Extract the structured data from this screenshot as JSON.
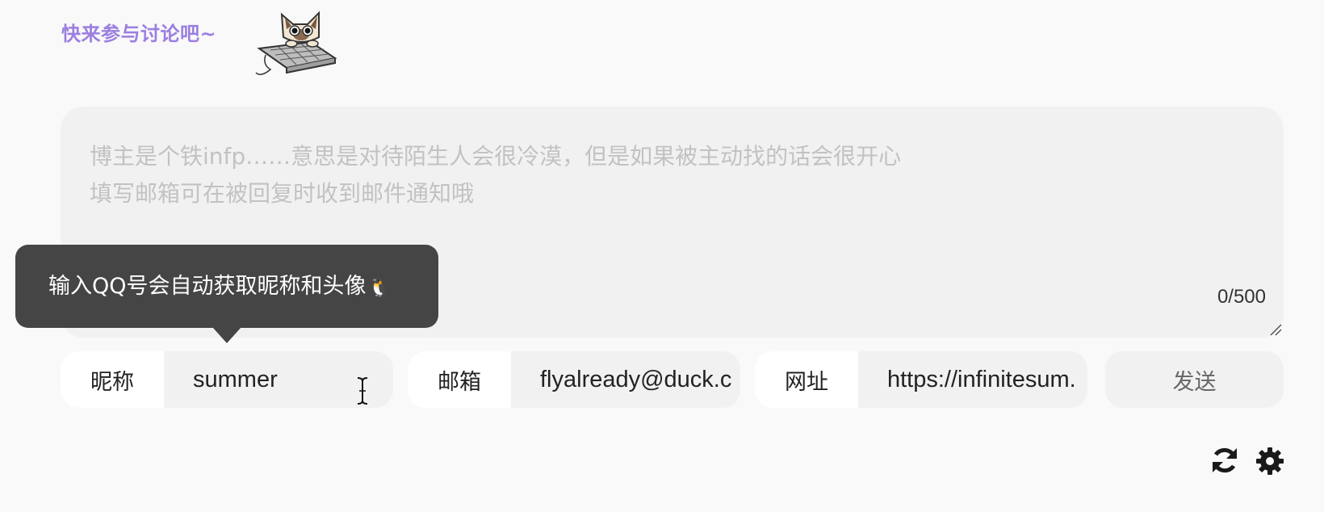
{
  "header": {
    "title": "快来参与讨论吧~"
  },
  "mascot": {
    "icon": "cat-typing-keyboard-icon"
  },
  "comment_box": {
    "placeholder_line1": "博主是个铁infp……意思是对待陌生人会很冷漠，但是如果被主动找的话会很开心",
    "placeholder_line2": "填写邮箱可在被回复时收到邮件通知哦",
    "counter": "0/500"
  },
  "tooltip": {
    "text": "输入QQ号会自动获取昵称和头像",
    "emoji": "🐧"
  },
  "form": {
    "nick": {
      "label": "昵称",
      "value": "summer"
    },
    "mail": {
      "label": "邮箱",
      "value": "flyalready@duck.c"
    },
    "url": {
      "label": "网址",
      "value": "https://infinitesum."
    },
    "send_label": "发送"
  },
  "footer_icons": [
    "refresh-icon",
    "gear-icon"
  ],
  "colors": {
    "accent": "#9b7fe0",
    "tooltip_bg": "#454545",
    "page_bg": "#f9f9f9",
    "input_bg": "#f1f1f1"
  }
}
